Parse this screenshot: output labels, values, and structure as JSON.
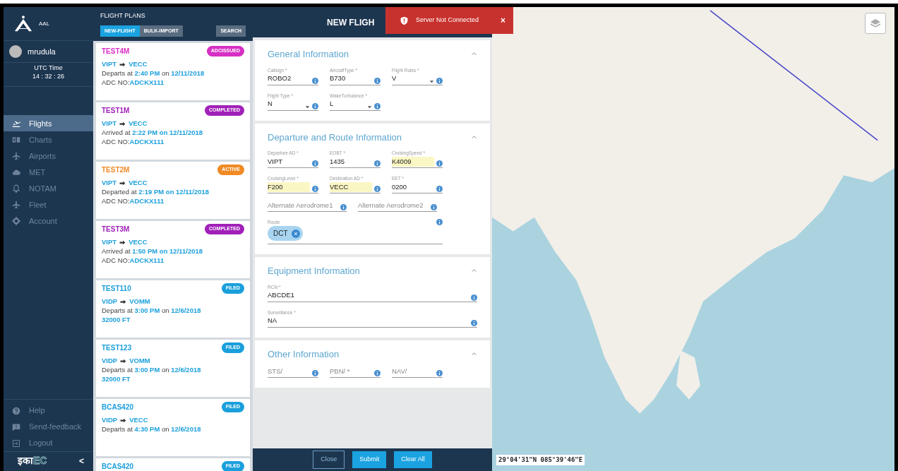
{
  "sidebar": {
    "brand": "AAL",
    "user": "mrudula",
    "utc_label": "UTC Time",
    "utc_time": "14 : 32 : 26",
    "nav": [
      {
        "label": "Flights",
        "selected": true,
        "disabled": false
      },
      {
        "label": "Charts",
        "selected": false,
        "disabled": true
      },
      {
        "label": "Airports",
        "selected": false,
        "disabled": true
      },
      {
        "label": "MET",
        "selected": false,
        "disabled": true
      },
      {
        "label": "NOTAM",
        "selected": false,
        "disabled": true
      },
      {
        "label": "Fleet",
        "selected": false,
        "disabled": true
      },
      {
        "label": "Account",
        "selected": false,
        "disabled": true
      }
    ],
    "footer": [
      {
        "label": "Help"
      },
      {
        "label": "Send-feedback"
      },
      {
        "label": "Logout"
      }
    ],
    "logo": [
      "इका",
      "EC"
    ],
    "collapse": "<"
  },
  "flight_plans": {
    "title": "FLIGHT PLANS",
    "tabs": [
      {
        "label": "NEW-FLIGHT",
        "selected": true
      },
      {
        "label": "BULK-IMPORT",
        "selected": false
      }
    ],
    "search": "SEARCH",
    "cards": [
      {
        "callsign": "TEST4M",
        "status": "ADCISSUED",
        "color": "#d62fc4",
        "from": "VIPT",
        "to": "VECC",
        "time": "Departs at **2:40 PM** on **12/11/2018**",
        "extra": "ADC NO:**ADCKX111**"
      },
      {
        "callsign": "TEST1M",
        "status": "COMPLETED",
        "color": "#a020b8",
        "from": "VIPT",
        "to": "VECC",
        "time": "Arrived at **2:22 PM on 12/11/2018**",
        "extra": "ADC NO:**ADCKX111**"
      },
      {
        "callsign": "TEST2M",
        "status": "ACTIVE",
        "color": "#f08a24",
        "from": "VIPT",
        "to": "VECC",
        "time": "Departed at **2:19 PM on 12/11/2018**",
        "extra": "ADC NO:**ADCKX111**"
      },
      {
        "callsign": "TEST3M",
        "status": "COMPLETED",
        "color": "#a020b8",
        "from": "VIPT",
        "to": "VECC",
        "time": "Arrived at **1:50 PM on 12/11/2018**",
        "extra": "ADC NO:**ADCKX111**"
      },
      {
        "callsign": "TEST110",
        "status": "FILED",
        "color": "#1a9fdc",
        "from": "VIDP",
        "to": "VOMM",
        "time": "Departs at **3:00 PM** on **12/6/2018**",
        "extra": "**32000 FT**"
      },
      {
        "callsign": "TEST123",
        "status": "FILED",
        "color": "#1a9fdc",
        "from": "VIDP",
        "to": "VOMM",
        "time": "Departs at **3:00 PM** on **12/6/2018**",
        "extra": "**32000 FT**"
      },
      {
        "callsign": "BCAS420",
        "status": "FILED",
        "color": "#1a9fdc",
        "from": "VIDP",
        "to": "VECC",
        "time": "Departs at **4:30 PM** on **12/6/2018**"
      },
      {
        "callsign": "BCAS420",
        "status": "FILED",
        "color": "#1a9fdc"
      }
    ]
  },
  "form": {
    "title": "NEW FLIGH",
    "sections": [
      {
        "title": "General Information",
        "expanded": true,
        "rows": [
          [
            {
              "kind": "text",
              "label": "Callsign *",
              "value": "ROBO2"
            },
            {
              "kind": "text",
              "label": "AircraftType *",
              "value": "B730"
            },
            {
              "kind": "select",
              "label": "Flight Rules *",
              "value": "V"
            }
          ],
          [
            {
              "kind": "select",
              "label": "Flight Type *",
              "value": "N"
            },
            {
              "kind": "select",
              "label": "WakeTurbulance *",
              "value": "L"
            }
          ]
        ]
      },
      {
        "title": "Departure and Route Information",
        "expanded": true,
        "rows": [
          [
            {
              "kind": "text",
              "label": "Departure AD *",
              "value": "VIPT"
            },
            {
              "kind": "text",
              "label": "EOBT *",
              "value": "1435"
            },
            {
              "kind": "text",
              "label": "CruisingSpeed *",
              "value": "K4009",
              "highlighted": true
            }
          ],
          [
            {
              "kind": "text",
              "label": "CruisingLevel *",
              "value": "F200",
              "highlighted": true
            },
            {
              "kind": "text",
              "label": "Destination AD *",
              "value": "VECC",
              "highlighted": true
            },
            {
              "kind": "text",
              "label": "EET *",
              "value": "0200"
            }
          ],
          [
            {
              "kind": "text",
              "placeholder": "Alternate Aerodrome1"
            },
            {
              "kind": "text",
              "placeholder": "Alternate Aerodrome2"
            }
          ],
          [
            {
              "kind": "chips",
              "label": "Route",
              "chips": [
                "DCT"
              ]
            }
          ]
        ]
      },
      {
        "title": "Equipment Information",
        "expanded": true,
        "rows": [
          [
            {
              "kind": "wide",
              "label": "RCN *",
              "value": "ABCDE1"
            }
          ],
          [
            {
              "kind": "wide",
              "label": "Surveillance *",
              "value": "NA"
            }
          ]
        ]
      },
      {
        "title": "Other Information",
        "expanded": true,
        "rows": [
          [
            {
              "kind": "text",
              "placeholder": "STS/"
            },
            {
              "kind": "text",
              "placeholder": "PBN/ *"
            },
            {
              "kind": "text",
              "placeholder": "NAV/"
            }
          ]
        ]
      }
    ],
    "buttons": [
      {
        "label": "Close",
        "kind": "outline"
      },
      {
        "label": "Submit",
        "kind": "primary"
      },
      {
        "label": "Clear All",
        "kind": "primary"
      }
    ]
  },
  "toast": {
    "message": "Server Not Connected",
    "close": "×"
  },
  "map": {
    "coordinates": "29°04'31\"N 085°39'46\"E"
  }
}
